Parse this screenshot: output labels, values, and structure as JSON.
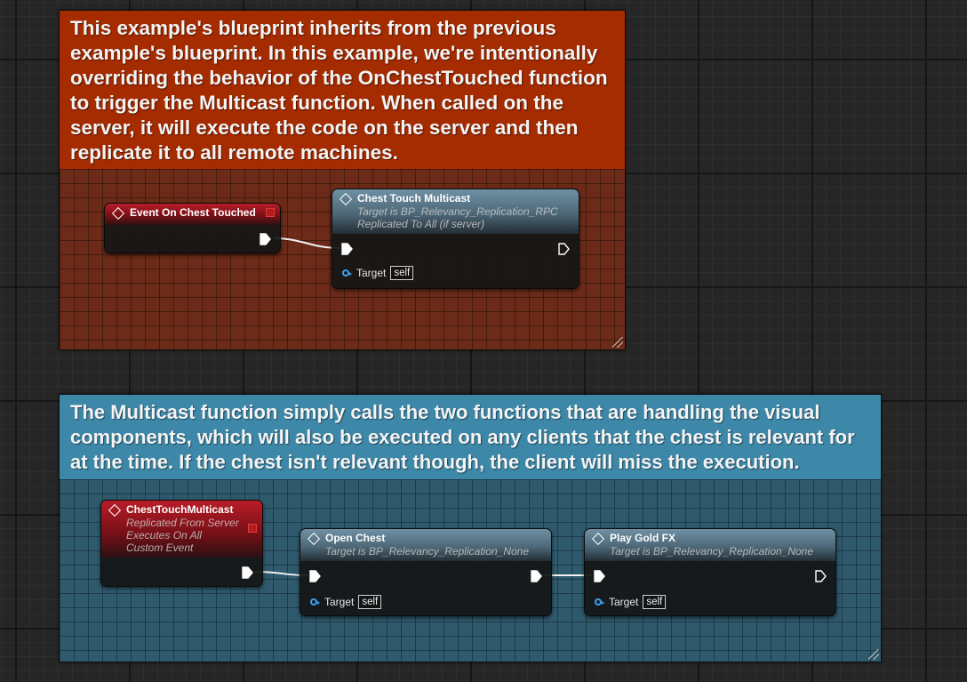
{
  "comments": {
    "top": "This example's blueprint inherits from the previous example's blueprint. In this example, we're intentionally overriding the behavior of the OnChestTouched function to trigger the Multicast function. When called on the server, it will execute the code on the server and then replicate it to all remote machines.",
    "bottom": "The Multicast function simply calls the two functions that are handling the visual components, which will also be executed on any clients that the chest is relevant for at the time. If the chest isn't relevant though, the client will miss the execution."
  },
  "nodes": {
    "event_on_chest_touched": {
      "title": "Event On Chest Touched"
    },
    "chest_touch_multicast_call": {
      "title": "Chest Touch Multicast",
      "subtitle1": "Target is BP_Relevancy_Replication_RPC",
      "subtitle2": "Replicated To All (if server)",
      "pin_label": "Target",
      "pin_default": "self"
    },
    "chest_touch_multicast_event": {
      "title": "ChestTouchMulticast",
      "subtitle1": "Replicated From Server",
      "subtitle2": "Executes On All",
      "subtitle3": "Custom Event"
    },
    "open_chest": {
      "title": "Open Chest",
      "subtitle1": "Target is BP_Relevancy_Replication_None",
      "pin_label": "Target",
      "pin_default": "self"
    },
    "play_gold_fx": {
      "title": "Play Gold FX",
      "subtitle1": "Target is BP_Relevancy_Replication_None",
      "pin_label": "Target",
      "pin_default": "self"
    }
  },
  "colors": {
    "comment_top": "#a52b00",
    "comment_bottom": "#3d88a8",
    "event_header": "#b81d28",
    "function_header": "#6f90a4",
    "object_pin": "#3aa1f0"
  }
}
